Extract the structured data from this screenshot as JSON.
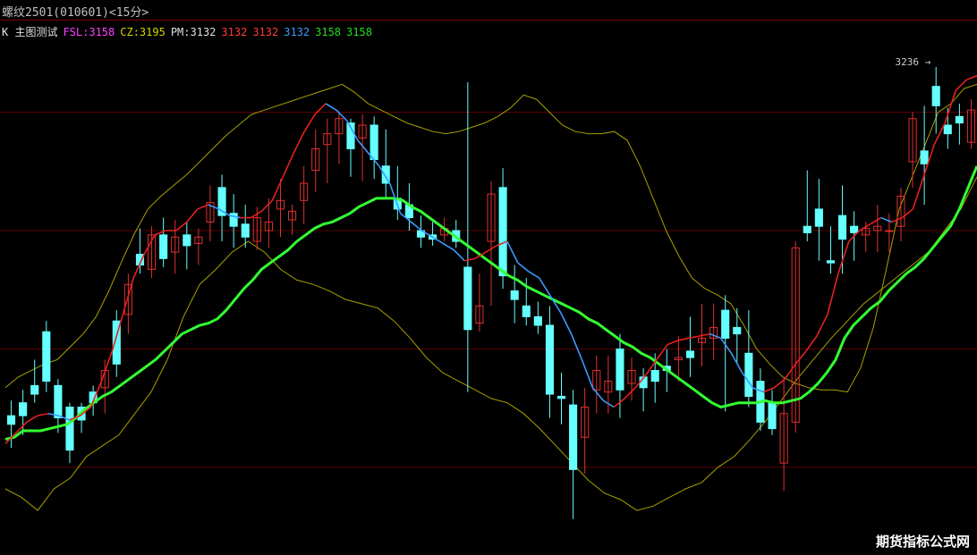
{
  "header": {
    "title": "螺纹2501(010601)<15分>"
  },
  "indicators": [
    {
      "text": "K 主图测试",
      "color": "#e0e0e0"
    },
    {
      "text": "FSL:3158",
      "color": "#ff40ff"
    },
    {
      "text": "CZ:3195",
      "color": "#d4d400"
    },
    {
      "text": "PM:3132",
      "color": "#e0e0e0"
    },
    {
      "text": "3132",
      "color": "#ff3b3b"
    },
    {
      "text": "3132",
      "color": "#ff3b3b"
    },
    {
      "text": "3132",
      "color": "#3a9bff"
    },
    {
      "text": "3158",
      "color": "#22dd22"
    },
    {
      "text": "3158",
      "color": "#22dd22"
    }
  ],
  "max_label": "3236",
  "watermark": "期货指标公式网",
  "colors": {
    "up": "#e03030",
    "down": "#66ffff",
    "thick_ma": "#33ff33",
    "short_ma_red": "#e82020",
    "short_ma_blue": "#3a9bff",
    "envelope": "#a8a000",
    "grid": "#5a0000"
  },
  "chart_data": {
    "type": "candlestick",
    "candles": [
      [
        3074,
        3081,
        3059,
        3070
      ],
      [
        3080,
        3086,
        3065,
        3074
      ],
      [
        3088,
        3100,
        3080,
        3084
      ],
      [
        3113,
        3118,
        3085,
        3090
      ],
      [
        3088,
        3091,
        3066,
        3073
      ],
      [
        3078,
        3080,
        3052,
        3058
      ],
      [
        3078,
        3080,
        3066,
        3072
      ],
      [
        3085,
        3088,
        3074,
        3080
      ],
      [
        3087,
        3100,
        3075,
        3095
      ],
      [
        3118,
        3123,
        3092,
        3098
      ],
      [
        3121,
        3140,
        3112,
        3135
      ],
      [
        3149,
        3161,
        3140,
        3144
      ],
      [
        3142,
        3162,
        3138,
        3158
      ],
      [
        3158,
        3166,
        3143,
        3147
      ],
      [
        3150,
        3165,
        3140,
        3157
      ],
      [
        3158,
        3164,
        3142,
        3153
      ],
      [
        3154,
        3161,
        3144,
        3157
      ],
      [
        3164,
        3181,
        3155,
        3173
      ],
      [
        3180,
        3186,
        3155,
        3167
      ],
      [
        3168,
        3177,
        3152,
        3162
      ],
      [
        3163,
        3172,
        3152,
        3157
      ],
      [
        3155,
        3171,
        3151,
        3166
      ],
      [
        3160,
        3175,
        3152,
        3164
      ],
      [
        3170,
        3184,
        3157,
        3174
      ],
      [
        3165,
        3172,
        3158,
        3169
      ],
      [
        3174,
        3190,
        3163,
        3182
      ],
      [
        3188,
        3207,
        3178,
        3198
      ],
      [
        3200,
        3212,
        3182,
        3205
      ],
      [
        3205,
        3215,
        3191,
        3212
      ],
      [
        3210,
        3212,
        3185,
        3198
      ],
      [
        3203,
        3214,
        3183,
        3209
      ],
      [
        3209,
        3213,
        3184,
        3193
      ],
      [
        3190,
        3207,
        3175,
        3182
      ],
      [
        3175,
        3190,
        3165,
        3170
      ],
      [
        3172,
        3182,
        3160,
        3166
      ],
      [
        3160,
        3167,
        3152,
        3157
      ],
      [
        3158,
        3164,
        3153,
        3156
      ],
      [
        3158,
        3166,
        3155,
        3161
      ],
      [
        3160,
        3165,
        3152,
        3155
      ],
      [
        3143,
        3229,
        3085,
        3114
      ],
      [
        3117,
        3140,
        3113,
        3125
      ],
      [
        3155,
        3183,
        3125,
        3177
      ],
      [
        3180,
        3189,
        3133,
        3139
      ],
      [
        3132,
        3144,
        3117,
        3128
      ],
      [
        3125,
        3138,
        3116,
        3120
      ],
      [
        3120,
        3127,
        3112,
        3116
      ],
      [
        3116,
        3125,
        3073,
        3084
      ],
      [
        3083,
        3094,
        3070,
        3082
      ],
      [
        3079,
        3086,
        3026,
        3049
      ],
      [
        3064,
        3087,
        3047,
        3078
      ],
      [
        3086,
        3102,
        3075,
        3095
      ],
      [
        3085,
        3102,
        3075,
        3090
      ],
      [
        3105,
        3112,
        3073,
        3086
      ],
      [
        3089,
        3101,
        3081,
        3095
      ],
      [
        3092,
        3096,
        3076,
        3087
      ],
      [
        3095,
        3103,
        3080,
        3090
      ],
      [
        3097,
        3105,
        3085,
        3095
      ],
      [
        3100,
        3111,
        3090,
        3101
      ],
      [
        3104,
        3120,
        3092,
        3101
      ],
      [
        3108,
        3126,
        3097,
        3110
      ],
      [
        3110,
        3126,
        3100,
        3115
      ],
      [
        3123,
        3130,
        3076,
        3110
      ],
      [
        3115,
        3124,
        3098,
        3112
      ],
      [
        3103,
        3123,
        3078,
        3083
      ],
      [
        3090,
        3096,
        3067,
        3071
      ],
      [
        3080,
        3086,
        3065,
        3068
      ],
      [
        3052,
        3092,
        3039,
        3075
      ],
      [
        3071,
        3155,
        3066,
        3152
      ],
      [
        3162,
        3188,
        3155,
        3159
      ],
      [
        3170,
        3184,
        3146,
        3162
      ],
      [
        3146,
        3162,
        3140,
        3145
      ],
      [
        3167,
        3181,
        3140,
        3156
      ],
      [
        3162,
        3169,
        3146,
        3159
      ],
      [
        3158,
        3164,
        3150,
        3161
      ],
      [
        3160,
        3172,
        3150,
        3162
      ],
      [
        3160,
        3168,
        3150,
        3160
      ],
      [
        3162,
        3180,
        3155,
        3176
      ],
      [
        3192,
        3215,
        3180,
        3212
      ],
      [
        3197,
        3218,
        3172,
        3191
      ],
      [
        3227,
        3236,
        3205,
        3218
      ],
      [
        3209,
        3217,
        3198,
        3205
      ],
      [
        3213,
        3219,
        3200,
        3210
      ],
      [
        3201,
        3221,
        3198,
        3216
      ]
    ],
    "ma_thick": [
      3063,
      3064,
      3067,
      3067,
      3067,
      3068,
      3069,
      3070,
      3073,
      3077,
      3080,
      3083,
      3085,
      3088,
      3091,
      3094,
      3097,
      3100,
      3104,
      3108,
      3112,
      3114,
      3116,
      3117,
      3119,
      3123,
      3128,
      3133,
      3137,
      3142,
      3145,
      3148,
      3151,
      3155,
      3158,
      3161,
      3163,
      3164,
      3166,
      3168,
      3171,
      3173,
      3175,
      3175,
      3175,
      3174,
      3171,
      3169,
      3166,
      3163,
      3160,
      3157,
      3154,
      3151,
      3148,
      3145,
      3142,
      3139,
      3137,
      3134,
      3132,
      3130,
      3128,
      3126,
      3124,
      3122,
      3119,
      3117,
      3114,
      3111,
      3108,
      3106,
      3103,
      3101,
      3098,
      3095,
      3092,
      3089,
      3086,
      3083,
      3080,
      3078,
      3079,
      3080,
      3080,
      3080,
      3081,
      3080,
      3080,
      3081,
      3082,
      3085,
      3089,
      3094,
      3100,
      3110,
      3116,
      3120,
      3124,
      3127,
      3132,
      3136,
      3140,
      3143,
      3147,
      3152,
      3157,
      3162,
      3170,
      3180,
      3190
    ],
    "ma_short": [
      3061,
      3066,
      3071,
      3074,
      3075,
      3074,
      3072,
      3074,
      3078,
      3090,
      3104,
      3121,
      3138,
      3149,
      3158,
      3160,
      3160,
      3164,
      3170,
      3172,
      3170,
      3167,
      3166,
      3166,
      3169,
      3174,
      3185,
      3196,
      3206,
      3214,
      3219,
      3216,
      3211,
      3202,
      3196,
      3190,
      3182,
      3168,
      3164,
      3160,
      3157,
      3154,
      3151,
      3146,
      3147,
      3150,
      3153,
      3155,
      3145,
      3141,
      3138,
      3130,
      3122,
      3112,
      3100,
      3087,
      3081,
      3078,
      3082,
      3087,
      3093,
      3100,
      3107,
      3109,
      3110,
      3111,
      3112,
      3110,
      3103,
      3094,
      3087,
      3085,
      3087,
      3091,
      3098,
      3104,
      3111,
      3121,
      3140,
      3155,
      3160,
      3163,
      3166,
      3164,
      3166,
      3170,
      3185,
      3200,
      3210,
      3225,
      3230,
      3232
    ],
    "env_upper": [
      3087,
      3092,
      3095,
      3098,
      3100,
      3106,
      3112,
      3120,
      3132,
      3146,
      3159,
      3170,
      3176,
      3181,
      3186,
      3192,
      3198,
      3204,
      3209,
      3214,
      3216,
      3218,
      3220,
      3222,
      3224,
      3226,
      3228,
      3224,
      3219,
      3216,
      3213,
      3210,
      3208,
      3206,
      3205,
      3206,
      3208,
      3210,
      3213,
      3217,
      3223,
      3221,
      3215,
      3209,
      3206,
      3205,
      3205,
      3206,
      3202,
      3190,
      3175,
      3160,
      3148,
      3138,
      3133,
      3130,
      3126,
      3116,
      3105,
      3098,
      3092,
      3089,
      3087,
      3086,
      3086,
      3085,
      3096,
      3115,
      3142,
      3170,
      3185,
      3200,
      3215,
      3219,
      3226,
      3228
    ],
    "env_lower": [
      3040,
      3036,
      3030,
      3040,
      3045,
      3055,
      3060,
      3065,
      3075,
      3085,
      3100,
      3120,
      3135,
      3142,
      3150,
      3155,
      3150,
      3142,
      3137,
      3135,
      3132,
      3128,
      3126,
      3124,
      3118,
      3110,
      3101,
      3094,
      3090,
      3086,
      3082,
      3080,
      3075,
      3068,
      3060,
      3052,
      3044,
      3038,
      3035,
      3030,
      3032,
      3036,
      3040,
      3043,
      3050,
      3055,
      3063,
      3072,
      3082,
      3092,
      3101,
      3110,
      3118,
      3126,
      3132,
      3138,
      3144,
      3150,
      3160,
      3170,
      3185
    ],
    "y_range": [
      3018,
      3258
    ],
    "grid_lines_y": [
      3215,
      3160,
      3105,
      3050
    ],
    "max_price": 3236
  }
}
